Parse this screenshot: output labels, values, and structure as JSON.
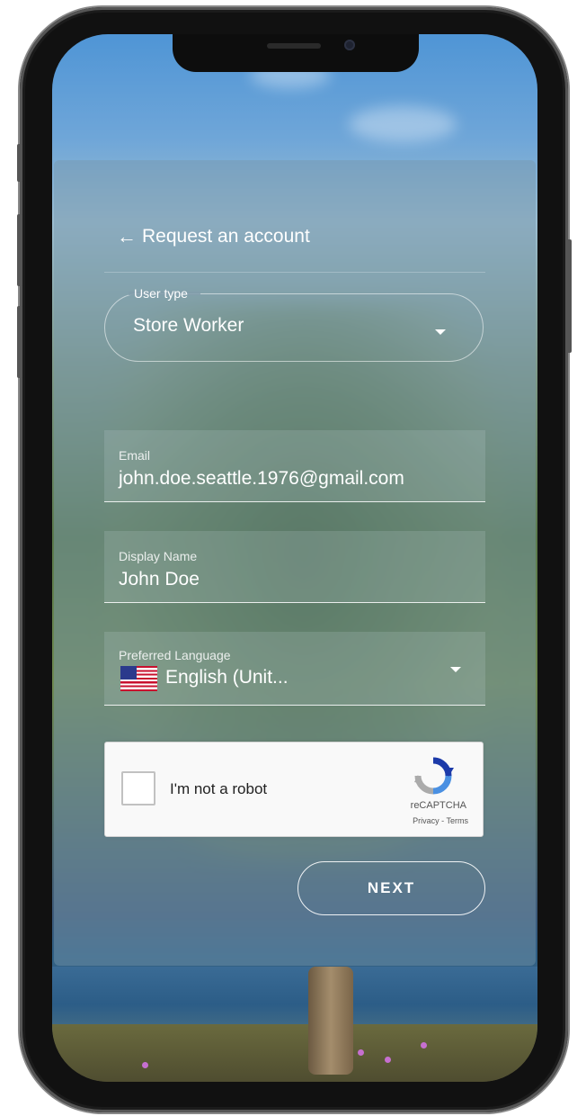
{
  "header": {
    "back_icon": "arrow-left-icon",
    "title": "Request an account"
  },
  "user_type": {
    "label": "User type",
    "value": "Store Worker"
  },
  "email": {
    "label": "Email",
    "value": "john.doe.seattle.1976@gmail.com"
  },
  "display_name": {
    "label": "Display Name",
    "value": "John Doe"
  },
  "language": {
    "label": "Preferred Language",
    "value": "English (Unit...",
    "flag_icon": "us-flag-icon"
  },
  "recaptcha": {
    "label": "I'm not a robot",
    "brand": "reCAPTCHA",
    "links": "Privacy - Terms"
  },
  "next_button": {
    "label": "NEXT"
  },
  "colors": {
    "accent": "#ffffff",
    "panel": "#789aa8"
  }
}
